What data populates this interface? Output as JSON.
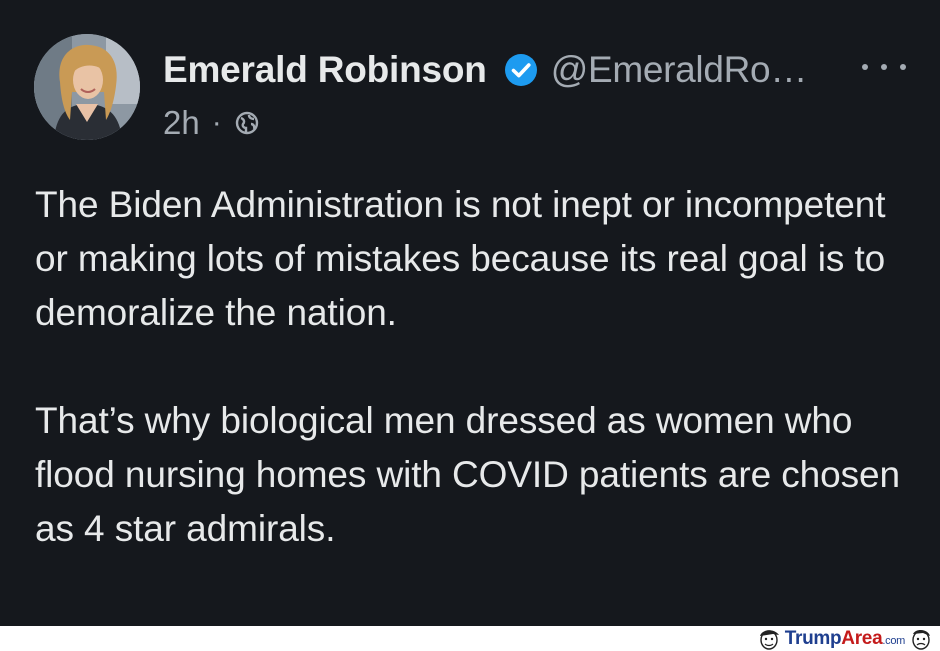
{
  "author": {
    "display_name": "Emerald Robinson",
    "handle": "@EmeraldRo…",
    "verified_icon": "verified-badge-icon",
    "avatar_icon": "profile-photo"
  },
  "meta": {
    "timestamp": "2h",
    "separator": "·",
    "audience_icon": "globe-icon"
  },
  "more_menu_icon": "more-options-icon",
  "tweet": {
    "paragraphs": [
      "The Biden Administration is not inept or incompetent or making lots of mistakes because its real goal is to demoralize the nation.",
      "That’s why biological men dressed as women who flood nursing homes with COVID patients are chosen as 4 star admirals."
    ]
  },
  "watermark": {
    "trump": "Trump",
    "area": "Area",
    "com": ".com"
  },
  "colors": {
    "background": "#15181d",
    "text": "#e7e9ea",
    "muted": "#a4abb3",
    "verified": "#1d9bf0"
  }
}
